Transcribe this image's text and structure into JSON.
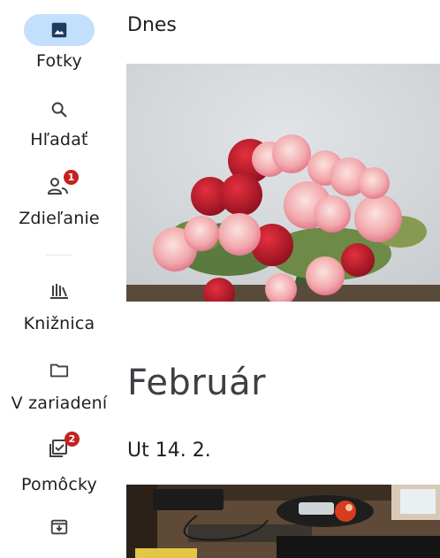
{
  "nav": {
    "photos_label": "Fotky",
    "search_label": "Hľadať",
    "sharing_label": "Zdieľanie",
    "sharing_badge": "1",
    "library_label": "Knižnica",
    "device_label": "V zariadení",
    "utilities_label": "Pomôcky",
    "utilities_badge": "2"
  },
  "feed": {
    "today_label": "Dnes",
    "month_title": "Február",
    "date_label": "Ut 14. 2."
  },
  "colors": {
    "accent": "#c2e0fb",
    "icon": "#3c4043",
    "badge": "#c5221f"
  }
}
